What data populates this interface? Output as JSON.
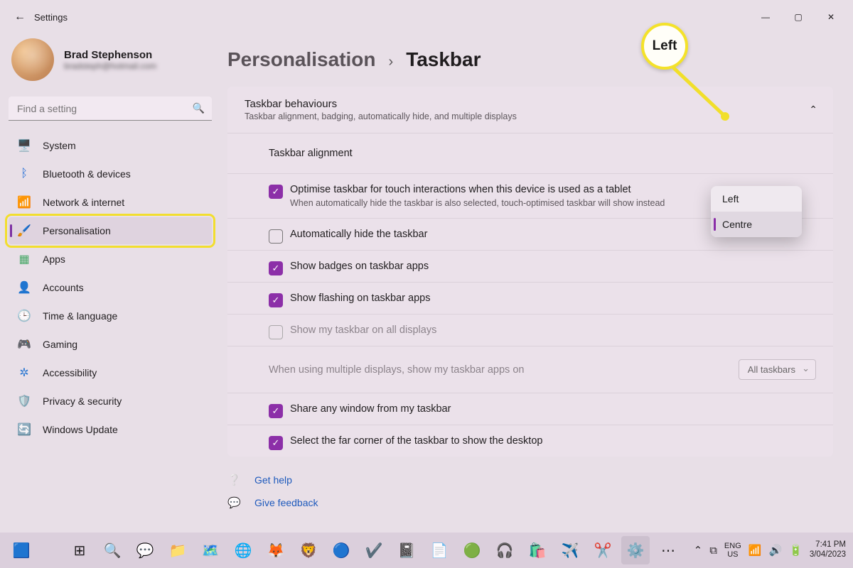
{
  "window": {
    "title": "Settings"
  },
  "profile": {
    "name": "Brad Stephenson",
    "email": "bradsteph@hotmail.com"
  },
  "search": {
    "placeholder": "Find a setting"
  },
  "sidebar": {
    "items": [
      {
        "icon": "🖥️",
        "label": "System"
      },
      {
        "icon": "ᛒ",
        "label": "Bluetooth & devices",
        "color": "#1e6fd9"
      },
      {
        "icon": "📶",
        "label": "Network & internet",
        "color": "#1e6fd9"
      },
      {
        "icon": "🖌️",
        "label": "Personalisation"
      },
      {
        "icon": "▦",
        "label": "Apps",
        "color": "#4a6"
      },
      {
        "icon": "👤",
        "label": "Accounts",
        "color": "#59b"
      },
      {
        "icon": "🕒",
        "label": "Time & language"
      },
      {
        "icon": "🎮",
        "label": "Gaming"
      },
      {
        "icon": "✲",
        "label": "Accessibility",
        "color": "#2a7bd4"
      },
      {
        "icon": "🛡️",
        "label": "Privacy & security"
      },
      {
        "icon": "🔄",
        "label": "Windows Update",
        "color": "#1e8ad6"
      }
    ],
    "active_index": 3,
    "highlighted_index": 3
  },
  "breadcrumb": {
    "parent": "Personalisation",
    "current": "Taskbar"
  },
  "section": {
    "title": "Taskbar behaviours",
    "subtitle": "Taskbar alignment, badging, automatically hide, and multiple displays"
  },
  "align_row": {
    "label": "Taskbar alignment"
  },
  "align_dropdown": {
    "options": [
      "Left",
      "Centre"
    ],
    "selected": "Centre"
  },
  "rows": [
    {
      "label": "Optimise taskbar for touch interactions when this device is used as a tablet",
      "sub": "When automatically hide the taskbar is also selected, touch-optimised taskbar will show instead",
      "checked": true
    },
    {
      "label": "Automatically hide the taskbar",
      "checked": false
    },
    {
      "label": "Show badges on taskbar apps",
      "checked": true
    },
    {
      "label": "Show flashing on taskbar apps",
      "checked": true
    },
    {
      "label": "Show my taskbar on all displays",
      "checked": false,
      "disabled": true
    },
    {
      "label": "When using multiple displays, show my taskbar apps on",
      "select_value": "All taskbars",
      "disabled": true,
      "is_select": true
    },
    {
      "label": "Share any window from my taskbar",
      "checked": true
    },
    {
      "label": "Select the far corner of the taskbar to show the desktop",
      "checked": true
    }
  ],
  "links": {
    "help": "Get help",
    "feedback": "Give feedback"
  },
  "callout": {
    "text": "Left"
  },
  "tray": {
    "lang1": "ENG",
    "lang2": "US",
    "time": "7:41 PM",
    "date": "3/04/2023"
  }
}
